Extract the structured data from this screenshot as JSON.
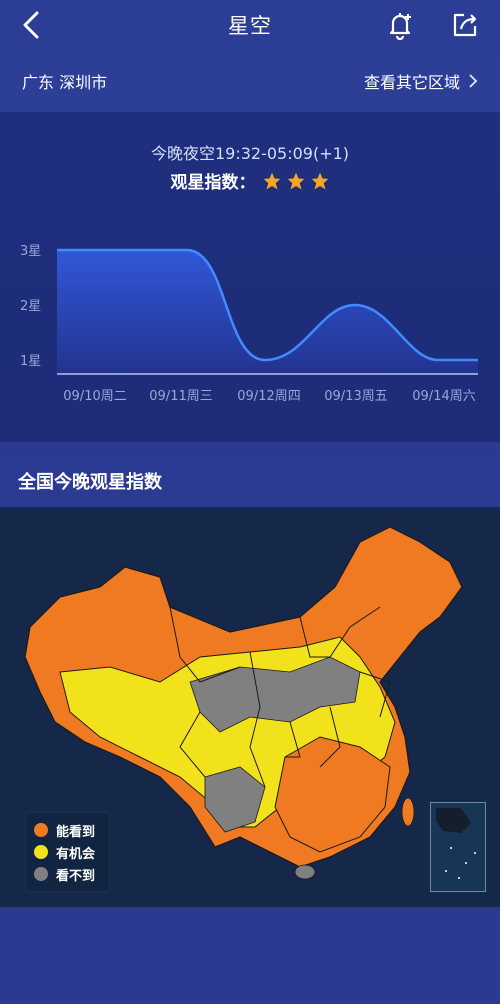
{
  "header": {
    "title": "星空"
  },
  "location": {
    "city": "广东 深圳市",
    "other_regions": "查看其它区域"
  },
  "tonight": {
    "window": "今晚夜空19:32-05:09(+1)",
    "index_label": "观星指数：",
    "star_rating": 3,
    "star_color": "#f5a623"
  },
  "chart_data": {
    "type": "area",
    "x": [
      "09/10周二",
      "09/11周三",
      "09/12周四",
      "09/13周五",
      "09/14周六"
    ],
    "values": [
      3,
      3,
      1,
      2,
      1
    ],
    "y_ticks": [
      "1星",
      "2星",
      "3星"
    ],
    "ylim": [
      1,
      3
    ],
    "line_color": "#3f8cff"
  },
  "national": {
    "title": "全国今晚观星指数"
  },
  "legend": [
    {
      "label": "能看到",
      "color": "#f07a22"
    },
    {
      "label": "有机会",
      "color": "#f2e21c"
    },
    {
      "label": "看不到",
      "color": "#808080"
    }
  ]
}
